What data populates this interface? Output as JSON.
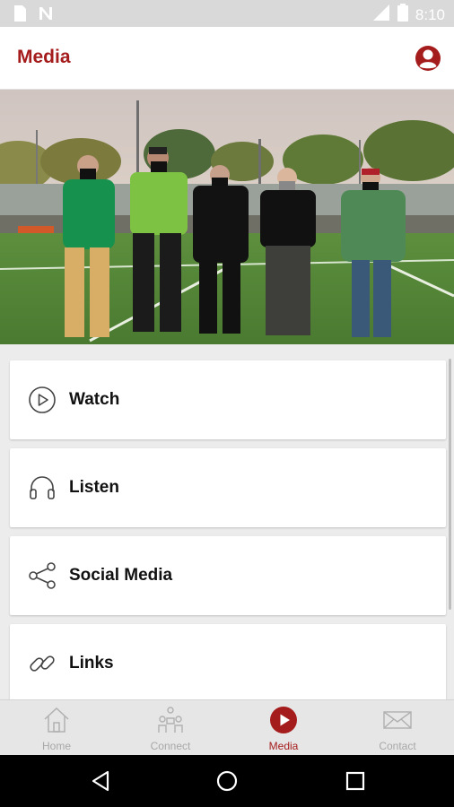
{
  "status_bar": {
    "time": "8:10",
    "icons": [
      "sim-card-icon",
      "n-notification-icon",
      "signal-icon",
      "battery-icon"
    ]
  },
  "header": {
    "title": "Media",
    "profile_icon": "account-circle-icon"
  },
  "hero": {
    "description_icon": "photo"
  },
  "menu": {
    "items": [
      {
        "label": "Watch",
        "icon": "play-circle-icon"
      },
      {
        "label": "Listen",
        "icon": "headphones-icon"
      },
      {
        "label": "Social Media",
        "icon": "share-icon"
      },
      {
        "label": "Links",
        "icon": "link-icon"
      }
    ]
  },
  "tabs": [
    {
      "label": "Home",
      "icon": "home-icon",
      "active": false
    },
    {
      "label": "Connect",
      "icon": "people-icon",
      "active": false
    },
    {
      "label": "Media",
      "icon": "play-circle-filled-icon",
      "active": true
    },
    {
      "label": "Contact",
      "icon": "envelope-icon",
      "active": false
    }
  ],
  "colors": {
    "accent": "#a51c1c",
    "tab_inactive": "#a8a8a8",
    "app_bar": "#ffffff",
    "background": "#ececec"
  }
}
